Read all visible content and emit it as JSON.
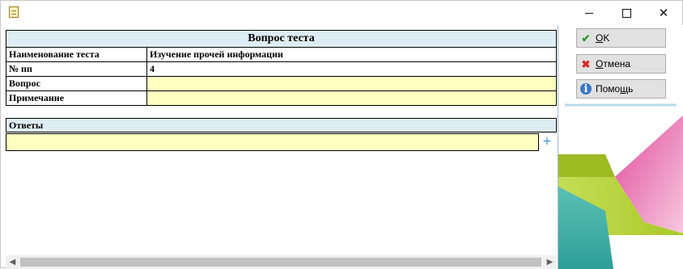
{
  "window": {
    "title": "",
    "controls": {
      "minimize": "—",
      "maximize": "☐",
      "close": "✕"
    }
  },
  "form": {
    "header": "Вопрос теста",
    "rows": [
      {
        "label": "Наименование теста",
        "value": "Изучение прочей информации",
        "editable": false
      },
      {
        "label": "№ пп",
        "value": "4",
        "editable": false
      },
      {
        "label": "Вопрос",
        "value": "",
        "editable": true
      },
      {
        "label": "Примечание",
        "value": "",
        "editable": true
      }
    ]
  },
  "answers": {
    "header": "Ответы",
    "value": "",
    "add_symbol": "+"
  },
  "scrollbar": {
    "left_arrow": "◀",
    "right_arrow": "▶"
  },
  "buttons": {
    "ok": {
      "label_first": "O",
      "label_rest": "K",
      "icon": "check-icon"
    },
    "cancel": {
      "label_first": "О",
      "label_rest": "тмена",
      "icon": "cross-icon"
    },
    "help": {
      "label_head": "Помо",
      "label_underlined": "щ",
      "label_tail": "ь",
      "icon": "info-icon"
    }
  },
  "colors": {
    "header_bg": "#deedf3",
    "input_bg": "#ffffc0",
    "accent_magenta": "#d9338a",
    "accent_green": "#b9d230",
    "accent_teal": "#3aaea5"
  }
}
